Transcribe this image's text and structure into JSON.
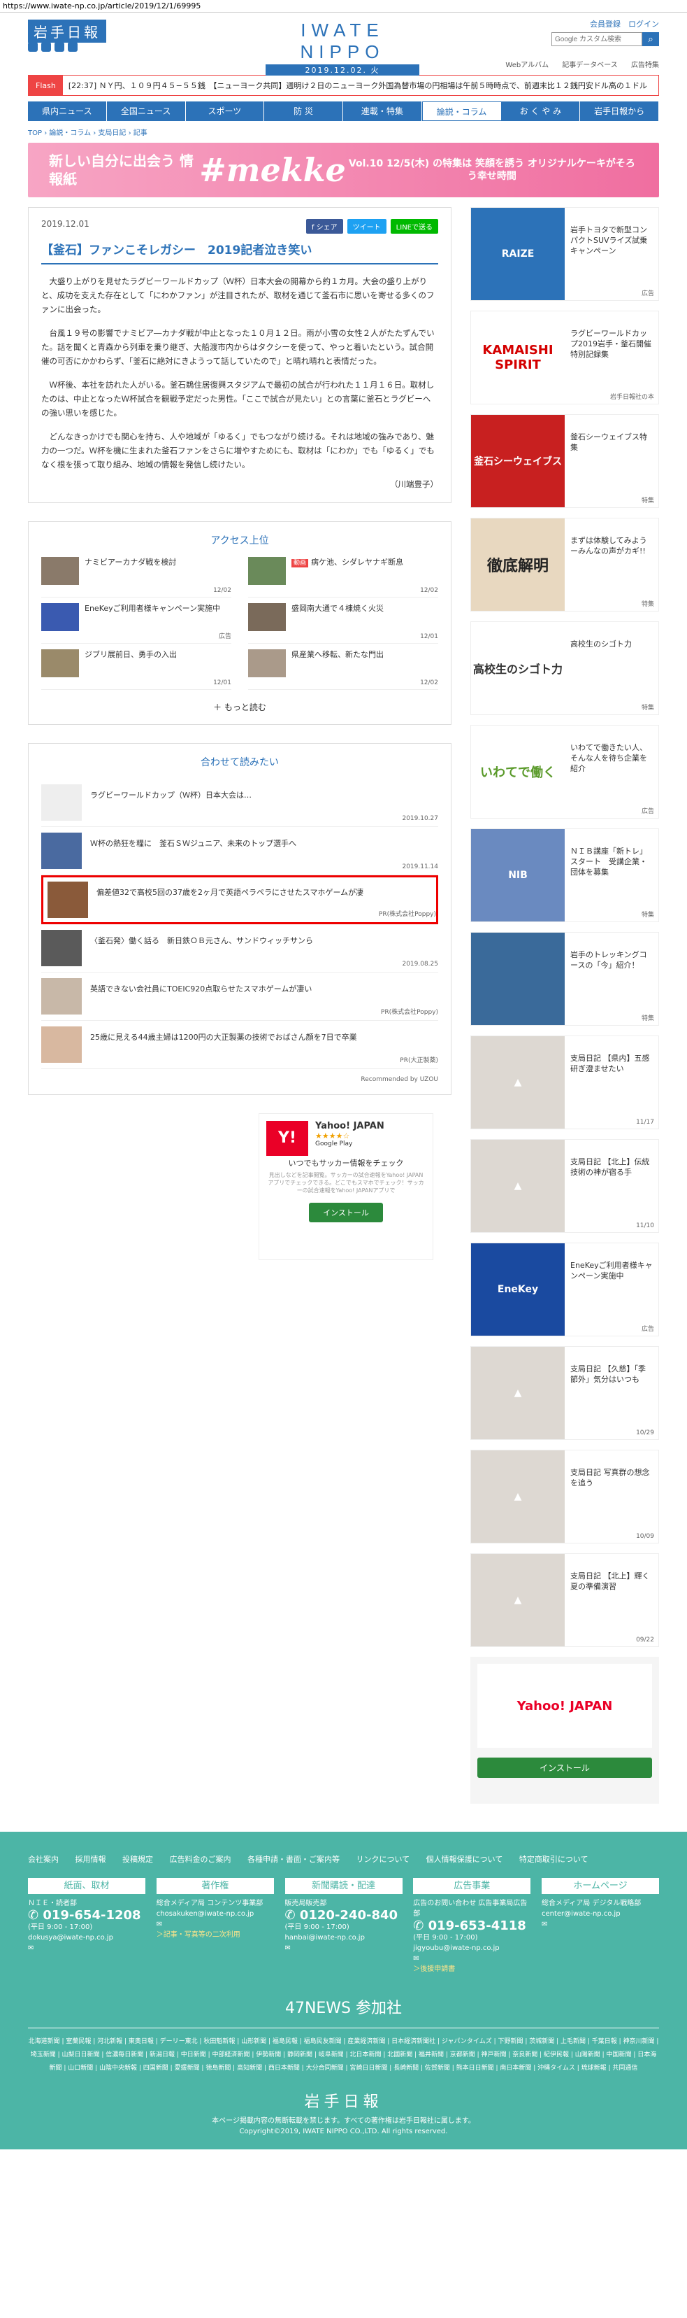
{
  "url": "https://www.iwate-np.co.jp/article/2019/12/1/69995",
  "header": {
    "logo": "岩手日報",
    "center_logo": "IWATE NIPPO",
    "date": "2019.12.02. 火",
    "links": "会員登録　ログイン",
    "search_placeholder": "Google カスタム検索"
  },
  "subnav": [
    "Webアルバム",
    "記事データベース",
    "広告特集"
  ],
  "flash": {
    "tag": "Flash",
    "text": "[22:37] ＮＹ円、１０９円４５−５５銭　【ニューヨーク共同】週明け２日のニューヨーク外国為替市場の円相場は午前５時時点で、前週末比１２銭円安ドル高の１ドル"
  },
  "gnav": [
    "県内ニュース",
    "全国ニュース",
    "スポーツ",
    "防 災",
    "連載・特集",
    "論説・コラム",
    "お く や み",
    "岩手日報から"
  ],
  "gnav_active": 5,
  "breadcrumb": "TOP › 論説・コラム › 支局日記 › 記事",
  "banner": {
    "left": "新しい自分に出会う 情報紙",
    "mid": "#mekke",
    "right": "Vol.10 12/5(木) の特集は 笑顔を誘う オリジナルケーキがそろう幸せ時間"
  },
  "article": {
    "date": "2019.12.01",
    "share": [
      "f シェア",
      "ツイート",
      "LINEで送る"
    ],
    "title": "【釜石】ファンこそレガシー　2019記者泣き笑い",
    "paragraphs": [
      "大盛り上がりを見せたラグビーワールドカップ（Ｗ杯）日本大会の開幕から約１カ月。大会の盛り上がりと、成功を支えた存在として「にわかファン」が注目されたが、取材を通じて釜石市に思いを寄せる多くのファンに出会った。",
      "台風１９号の影響でナミビア―カナダ戦が中止となった１０月１２日。雨が小雪の女性２人がたたずんでいた。話を聞くと青森から列車を乗り継ぎ、大船渡市内からはタクシーを使って、やっと着いたという。試合開催の可否にかかわらず、「釜石に絶対にきようって話していたので」と晴れ晴れと表情だった。",
      "Ｗ杯後、本社を訪れた人がいる。釜石鵜住居復興スタジアムで最初の試合が行われた１１月１６日。取材したのは、中止となったＷ杯試合を観戦予定だった男性。「ここで試合が見たい」との言葉に釜石とラグビーへの強い思いを感じた。",
      "どんなきっかけでも関心を持ち、人や地域が「ゆるく」でもつながり続ける。それは地域の強みであり、魅力の一つだ。Ｗ杯を機に生まれた釜石ファンをさらに増やすためにも、取材は「にわか」でも「ゆるく」でもなく根を張って取り組み、地域の情報を発信し続けたい。"
    ],
    "author": "（川端豊子）"
  },
  "ranking": {
    "title": "アクセス上位",
    "items": [
      {
        "title": "ナミビアーカナダ戦を検討",
        "date": "12/02",
        "badge": ""
      },
      {
        "title": "病ケ池、シダレヤナギ断息",
        "date": "12/02",
        "badge": "動画"
      },
      {
        "title": "EneKeyご利用者様キャンペーン実施中",
        "date": "広告",
        "badge": ""
      },
      {
        "title": "盛岡南大通で４棟焼く火災",
        "date": "12/01",
        "badge": ""
      },
      {
        "title": "ジブリ展前日、勇手の入出",
        "date": "12/01",
        "badge": ""
      },
      {
        "title": "県産業へ移転、新たな門出",
        "date": "12/02",
        "badge": ""
      }
    ],
    "more": "もっと読む"
  },
  "related": {
    "title": "合わせて読みたい",
    "items": [
      {
        "title": "ラグビーワールドカップ（Ｗ杯）日本大会は…",
        "date": "2019.10.27",
        "blank": true,
        "hl": false
      },
      {
        "title": "Ｗ杯の熱狂を糧に　釜石ＳＷジュニア、未来のトップ選手へ",
        "date": "2019.11.14",
        "blank": false,
        "hl": false
      },
      {
        "title": "偏差値32で高校5回の37歳を2ヶ月で英語ペラペラにさせたスマホゲームが凄",
        "date": "PR(株式会社Poppy)",
        "blank": false,
        "hl": true
      },
      {
        "title": "〈釜石発〉働く話る　新日鉄ＯＢ元さん、サンドウィッチサンら",
        "date": "2019.08.25",
        "blank": false,
        "hl": false
      },
      {
        "title": "英語できない会社員にTOEIC920点取らせたスマホゲームが凄い",
        "date": "PR(株式会社Poppy)",
        "blank": false,
        "hl": false
      },
      {
        "title": "25歳に見える44歳主婦は1200円の大正製薬の技術でおばさん顔を7日で卒業",
        "date": "PR(大正製薬)",
        "blank": false,
        "hl": false
      }
    ],
    "recby": "Recommended by UZOU"
  },
  "ad_main": {
    "logo": "Y!",
    "name": "Yahoo! JAPAN",
    "store": "Google Play",
    "desc": "いつでもサッカー情報をチェック",
    "sub": "見出しなどを記事閲覧。サッカーの試合速報をYahoo! JAPANアプリでチェックできる。どこでもスマホでチェック！サッカーの試合速報をYahoo! JAPANアプリで",
    "btn": "インストール"
  },
  "sidebar": [
    {
      "img": "RAIZE",
      "color": "#2c72b8",
      "title": "岩手トヨタで新型コンパクトSUVライズ試乗キャンペーン",
      "date": "広告"
    },
    {
      "img": "KAMAISHI SPIRIT",
      "color": "#d40000",
      "title": "ラグビーワールドカップ2019岩手・釜石開催特別記録集",
      "date": "岩手日報社の本"
    },
    {
      "img": "釜石シーウェイブス",
      "color": "#c82020",
      "title": "釜石シーウェイブス特集",
      "date": "特集"
    },
    {
      "img": "徹底解明",
      "color": "#8a6a4a",
      "title": "まずは体験してみようーみんなの声がカギ!!",
      "date": "特集"
    },
    {
      "img": "高校生のシゴト力",
      "color": "#9ac06a",
      "title": "高校生のシゴト力",
      "date": "特集"
    },
    {
      "img": "いわてで働く",
      "color": "#7ab04a",
      "title": "いわてで働きたい人、そんな人を待ち企業を紹介",
      "date": "広告"
    },
    {
      "img": "NIB",
      "color": "#6a8ac0",
      "title": "ＮＩＢ講座「新トレ」スタート　受講企業・団体を募集",
      "date": "特集"
    },
    {
      "img": "",
      "color": "#3a6a9a",
      "title": "岩手のトレッキングコースの「今」紹介！",
      "date": "特集"
    },
    {
      "img": "",
      "color": "gray",
      "title": "支局日記 【県内】五感研ぎ澄ませたい",
      "date": "11/17"
    },
    {
      "img": "",
      "color": "gray",
      "title": "支局日記 【北上】伝統技術の神が宿る手",
      "date": "11/10"
    },
    {
      "img": "EneKey",
      "color": "#1a4aa0",
      "title": "EneKeyご利用者様キャンペーン実施中",
      "date": "広告"
    },
    {
      "img": "",
      "color": "gray",
      "title": "支局日記 【久慈】「季節外」気分はいつも",
      "date": "10/29"
    },
    {
      "img": "",
      "color": "gray",
      "title": "支局日記 写真群の想念を追う",
      "date": "10/09"
    },
    {
      "img": "",
      "color": "gray",
      "title": "支局日記 【北上】輝く夏の準備演習",
      "date": "09/22"
    }
  ],
  "ad_side": {
    "name": "Yahoo! JAPAN",
    "btn": "インストール"
  },
  "footer": {
    "links": [
      "会社案内",
      "採用情報",
      "投稿規定",
      "広告料金のご案内",
      "各種申請・書面・ご案内等",
      "リンクについて",
      "個人情報保護について",
      "特定商取引について"
    ],
    "boxes": [
      {
        "h": "紙面、取材",
        "sub": "ＮＩＥ・読者部",
        "tel": "019-654-1208",
        "hours": "(平日 9:00 - 17:00)",
        "mail": "dokusya@iwate-np.co.jp",
        "lnk": ""
      },
      {
        "h": "著作権",
        "sub": "総合メディア局 コンテンツ事業部",
        "tel": "",
        "hours": "",
        "mail": "chosakuken@iwate-np.co.jp",
        "lnk": "＞記事・写真等の二次利用"
      },
      {
        "h": "新聞購読・配達",
        "sub": "販売局販売部",
        "tel": "0120-240-840",
        "hours": "(平日 9:00 - 17:00)",
        "mail": "hanbai@iwate-np.co.jp",
        "lnk": ""
      },
      {
        "h": "広告事業",
        "sub": "広告のお問い合わせ 広告事業局広告部",
        "tel": "019-653-4118",
        "hours": "(平日 9:00 - 17:00)",
        "mail": "jigyoubu@iwate-np.co.jp",
        "lnk": "＞後援申請書"
      },
      {
        "h": "ホームページ",
        "sub": "総合メディア局 デジタル戦略部",
        "tel": "",
        "hours": "",
        "mail": "center@iwate-np.co.jp",
        "lnk": ""
      }
    ],
    "news47": "47NEWS 参加社",
    "members": "北海道新聞 | 室蘭民報 | 河北新報 | 東奥日報 | デーリー東北 | 秋田魁新報 | 山形新聞 | 福島民報 | 福島民友新聞 | 産業経済新聞 | 日本経済新聞社 | ジャパンタイムズ | 下野新聞 | 茨城新聞 | 上毛新聞 | 千葉日報 | 神奈川新聞 | 埼玉新聞 | 山梨日日新聞 | 信濃毎日新聞 | 新潟日報 | 中日新聞 | 中部経済新聞 | 伊勢新聞 | 静岡新聞 | 岐阜新聞 | 北日本新聞 | 北國新聞 | 福井新聞 | 京都新聞 | 神戸新聞 | 奈良新聞 | 紀伊民報 | 山陽新聞 | 中国新聞 | 日本海新聞 | 山口新聞 | 山陰中央新報 | 四国新聞 | 愛媛新聞 | 徳島新聞 | 高知新聞 | 西日本新聞 | 大分合同新聞 | 宮崎日日新聞 | 長崎新聞 | 佐賀新聞 | 熊本日日新聞 | 南日本新聞 | 沖縄タイムス | 琉球新報 | 共同通信",
    "logo": "岩手日報",
    "note": "本ページ掲載内容の無断転載を禁じます。すべての著作権は岩手日報社に属します。",
    "copyright": "Copyright©2019, IWATE NIPPO CO.,LTD. All rights reserved."
  }
}
